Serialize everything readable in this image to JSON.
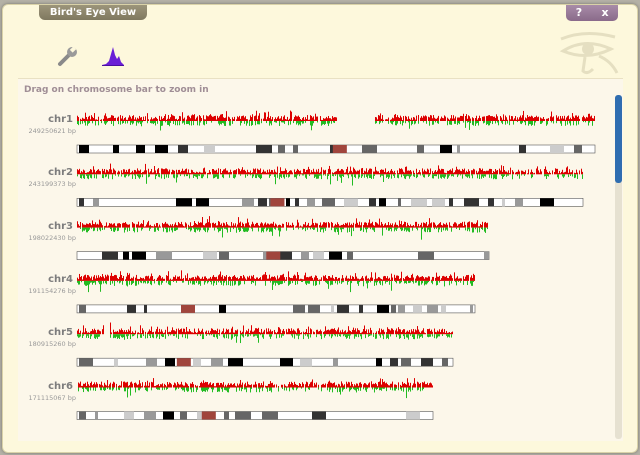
{
  "window": {
    "title": "Bird's Eye View",
    "help_label": "?",
    "close_label": "x"
  },
  "toolbar": [
    {
      "name": "wrench-icon",
      "tooltip": ""
    },
    {
      "name": "histogram-icon",
      "tooltip": ""
    }
  ],
  "panel": {
    "hint": "Drag on chromosome bar to zoom in"
  },
  "colors": {
    "gain": "#dd0000",
    "loss": "#22bb22",
    "centromere": "#a0453c",
    "accent": "#2f6db0"
  },
  "chromosomes": [
    {
      "name": "chr1",
      "bp": "249250621 bp",
      "length": 249250621,
      "centromere_mb": 123,
      "gap_mb": [
        125,
        143
      ]
    },
    {
      "name": "chr2",
      "bp": "243199373 bp",
      "length": 243199373,
      "centromere_mb": 93,
      "gap_mb": []
    },
    {
      "name": "chr3",
      "bp": "198022430 bp",
      "length": 198022430,
      "centromere_mb": 91,
      "gap_mb": []
    },
    {
      "name": "chr4",
      "bp": "191154276 bp",
      "length": 191154276,
      "centromere_mb": 50,
      "gap_mb": []
    },
    {
      "name": "chr5",
      "bp": "180915260 bp",
      "length": 180915260,
      "centromere_mb": 48,
      "gap_mb": []
    },
    {
      "name": "chr6",
      "bp": "171115067 bp",
      "length": 171115067,
      "centromere_mb": 60,
      "gap_mb": []
    }
  ]
}
